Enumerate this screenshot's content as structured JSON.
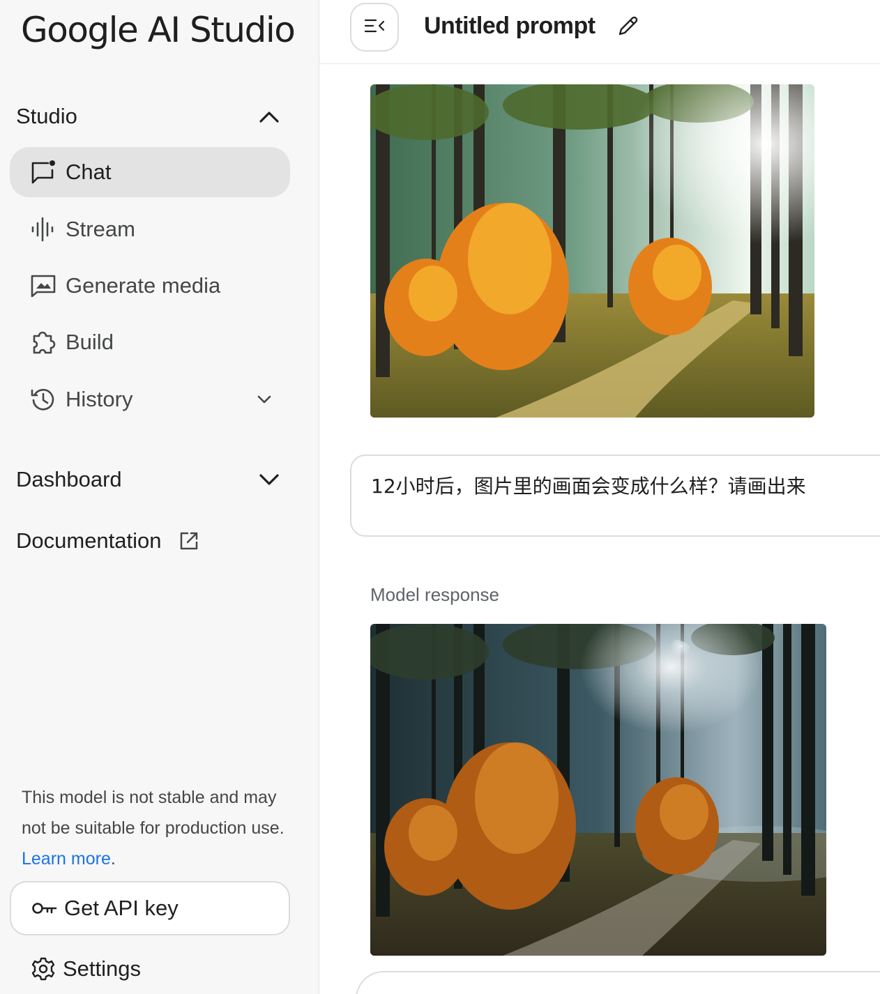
{
  "app": {
    "logo_text": "Google AI Studio"
  },
  "sidebar": {
    "studio_label": "Studio",
    "items": [
      {
        "label": "Chat",
        "icon": "chat-icon",
        "active": true
      },
      {
        "label": "Stream",
        "icon": "waveform-icon"
      },
      {
        "label": "Generate media",
        "icon": "image-icon"
      },
      {
        "label": "Build",
        "icon": "puzzle-icon"
      },
      {
        "label": "History",
        "icon": "history-icon"
      }
    ],
    "dashboard_label": "Dashboard",
    "documentation_label": "Documentation",
    "notice_text": "This model is not stable and may not be suitable for production use. ",
    "notice_link": "Learn more",
    "notice_end": ".",
    "api_key_label": "Get API key",
    "settings_label": "Settings"
  },
  "main": {
    "title": "Untitled prompt",
    "user_message": "12小时后，图片里的画面会变成什么样？请画出来",
    "model_label": "Model response"
  },
  "colors": {
    "link": "#1a73e8",
    "active_bg": "#e3e3e3",
    "sidebar_bg": "#f7f7f7"
  }
}
